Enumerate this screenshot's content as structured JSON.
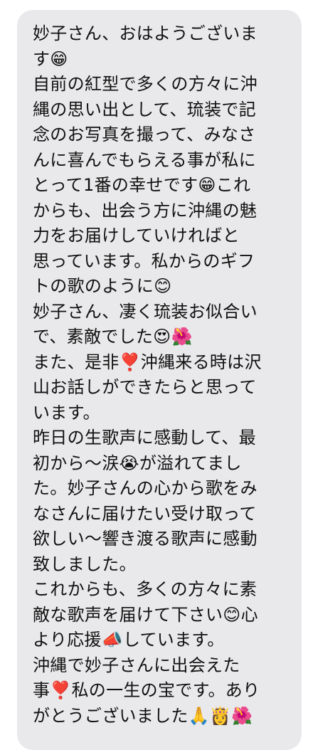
{
  "message": {
    "lines": [
      "妙子さん、おはようございま",
      "す😁",
      "自前の紅型で多くの方々に沖",
      "縄の思い出として、琉装で記",
      "念のお写真を撮って、みなさ",
      "んに喜んでもらえる事が私に",
      "とって1番の幸せです😁これ",
      "からも、出会う方に沖縄の魅",
      "力をお届けしていければと",
      "思っています。私からのギフ",
      "トの歌のように😊",
      "妙子さん、凄く琉装お似合い",
      "で、素敵でした😍🌺",
      "また、是非❣️沖縄来る時は沢",
      "山お話しができたらと思って",
      "います。",
      "昨日の生歌声に感動して、最",
      "初から〜涙😭が溢れてまし",
      "た。妙子さんの心から歌をみ",
      "なさんに届けたい受け取って",
      "欲しい〜響き渡る歌声に感動",
      "致しました。",
      "これからも、多くの方々に素",
      "敵な歌声を届けて下さい😊心",
      "より応援📣しています。",
      "沖縄で妙子さんに出会えた",
      "事❣️私の一生の宝です。あり",
      "がとうございました🙏👸🌺"
    ]
  }
}
